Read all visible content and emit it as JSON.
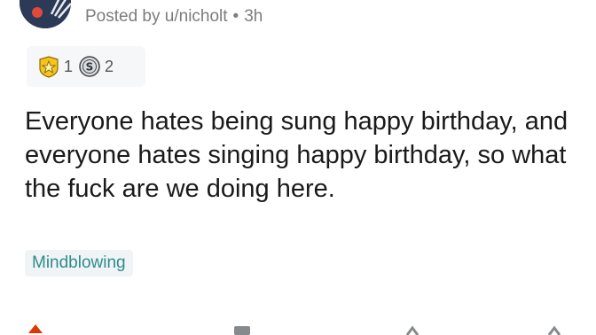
{
  "post": {
    "meta": {
      "posted_by": "Posted by u/nicholt",
      "time": "3h"
    },
    "awards": [
      {
        "icon": "star-award-icon",
        "count": "1"
      },
      {
        "icon": "silver-award-icon",
        "count": "2"
      }
    ],
    "title": "Everyone hates being sung happy birthday, and everyone hates singing happy birthday, so what the fuck are we doing here.",
    "flair": "Mindblowing"
  },
  "colors": {
    "meta_text": "#7c7c7c",
    "title_text": "#1a1a1b",
    "flair_text": "#2f8c8c",
    "flair_bg": "#f0f4f6",
    "award_bg": "#f6f7f8",
    "upvote": "#d93a00"
  }
}
